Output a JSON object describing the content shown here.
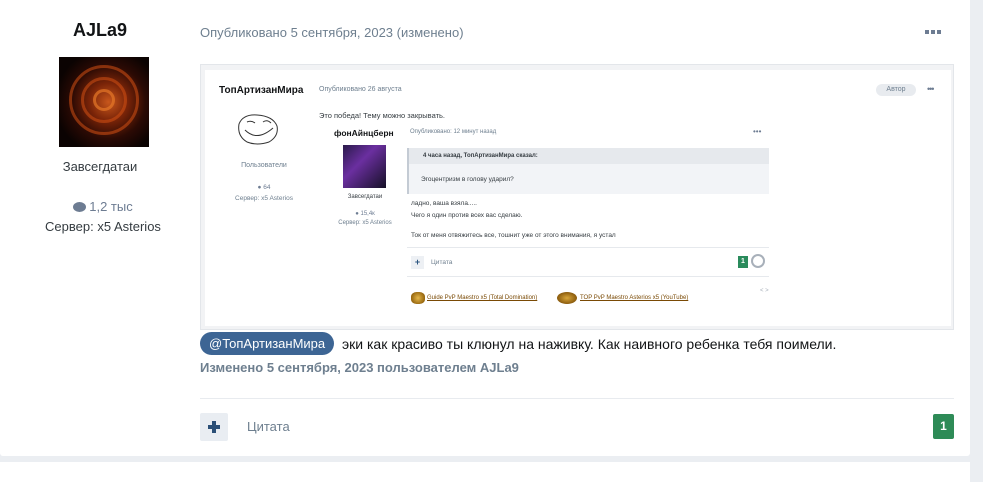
{
  "author": {
    "name": "AJLa9",
    "group": "Завсегдатаи",
    "posts": "1,2 тыс",
    "server": "Сервер: x5 Asterios"
  },
  "post": {
    "meta": "Опубликовано 5 сентября, 2023 (изменено)",
    "mention": "@ТопАртизанМира",
    "text": "эки как красиво ты клюнул на наживку. Как наивного ребенка тебя поимели.",
    "edited": "Изменено 5 сентября, 2023 пользователем AJLa9",
    "quote_label": "Цитата",
    "reputation": "1",
    "menu_icon": "ellipsis-icon"
  },
  "screenshot": {
    "author": "ТопАртизанМира",
    "meta": "Опубликовано 26 августа",
    "badge": "Автор",
    "dots": "•••",
    "text": "Это победа! Тему можно закрывать.",
    "group": "Пользователи",
    "posts": "64",
    "server": "Сервер: x5 Asterios",
    "quoted": {
      "author": "фонАйнцберн",
      "meta": "Опубликовано: 12 минут назад",
      "dots": "•••",
      "group": "Завсегдатаи",
      "posts": "15,4к",
      "server": "Сервер: x5 Asterios",
      "quote_head": "4 часа назад, ТопАртизанМира сказал:",
      "quote_text": "Эгоцентризм в голову ударил?",
      "line1": "ладно, ваша взяла.....",
      "line2": "Чего я один против всех вас сделаю.",
      "line3": "Ток от меня отвяжитесь все, тошнит уже от этого внимания, я устал",
      "cite": "Цитата",
      "rep": "1",
      "sig1": "Guide PvP Maestro x5 (Total Domination)",
      "sig2": "TOP PvP Maestro Asterios x5 (YouTube)",
      "sig_dots": "< >"
    }
  }
}
